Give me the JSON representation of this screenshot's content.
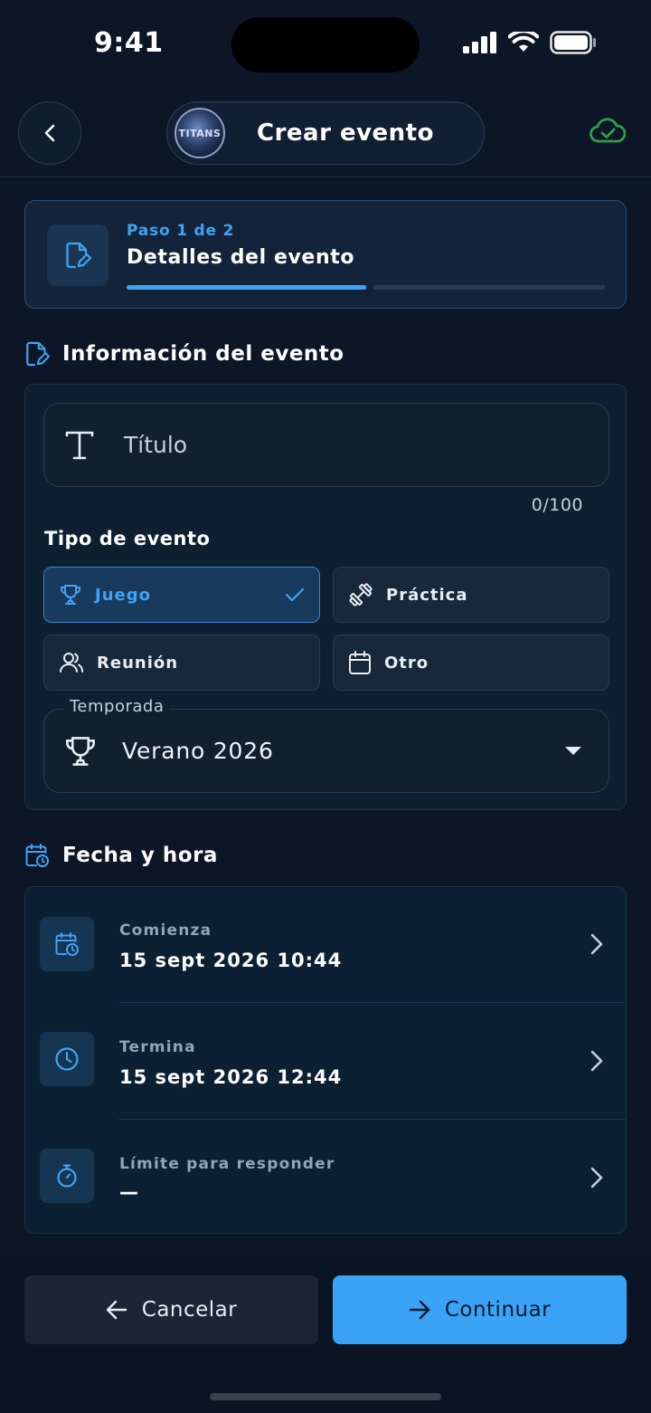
{
  "status_bar": {
    "time": "9:41"
  },
  "header": {
    "title": "Crear evento",
    "logo_text": "TITANS",
    "sync_color": "#2e9f4b"
  },
  "step": {
    "label": "Paso 1 de 2",
    "title": "Detalles del evento",
    "progress": 0.5
  },
  "info_section": {
    "heading": "Información del evento",
    "title_placeholder": "Título",
    "counter": "0/100",
    "type_label": "Tipo de evento",
    "types": [
      {
        "label": "Juego",
        "icon": "trophy-icon",
        "selected": true
      },
      {
        "label": "Práctica",
        "icon": "dumbbell-icon",
        "selected": false
      },
      {
        "label": "Reunión",
        "icon": "users-icon",
        "selected": false
      },
      {
        "label": "Otro",
        "icon": "calendar-icon",
        "selected": false
      }
    ],
    "season": {
      "label": "Temporada",
      "value": "Verano 2026"
    }
  },
  "date_section": {
    "heading": "Fecha y hora",
    "rows": [
      {
        "label": "Comienza",
        "value": "15 sept 2026 10:44",
        "icon": "calendar-clock-icon"
      },
      {
        "label": "Termina",
        "value": "15 sept 2026 12:44",
        "icon": "clock-icon"
      },
      {
        "label": "Límite para responder",
        "value": "—",
        "icon": "stopwatch-icon"
      }
    ]
  },
  "footer": {
    "cancel_label": "Cancelar",
    "continue_label": "Continuar"
  },
  "colors": {
    "accent": "#3aa3f6",
    "background": "#0c1626"
  }
}
